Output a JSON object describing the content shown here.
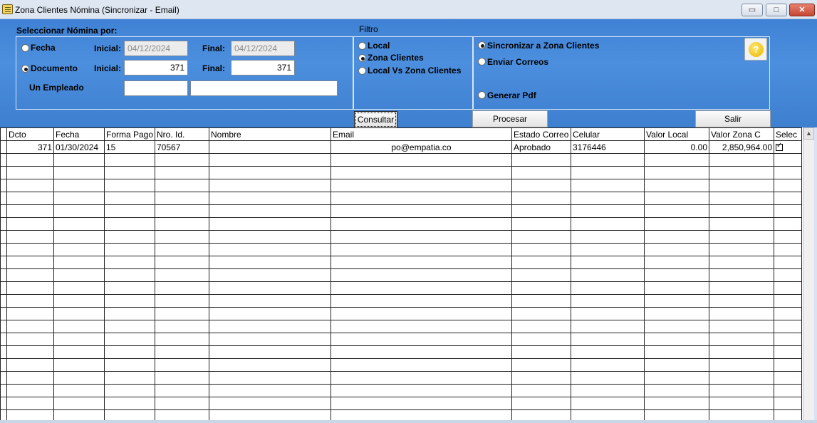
{
  "window": {
    "title": "Zona Clientes Nómina (Sincronizar - Email)",
    "min_label": "▭",
    "max_label": "□",
    "close_label": "✕"
  },
  "selection": {
    "heading": "Seleccionar Nómina por:",
    "fecha_label": "Fecha",
    "documento_label": "Documento",
    "inicial_label": "Inicial:",
    "final_label": "Final:",
    "fecha_inicial": "04/12/2024",
    "fecha_final": "04/12/2024",
    "doc_inicial": "371",
    "doc_final": "371",
    "empleado_label": "Un Empleado",
    "empleado_code": "",
    "empleado_name": "",
    "selected": "documento"
  },
  "filtro": {
    "heading": "Filtro",
    "options": [
      "Local",
      "Zona Clientes",
      "Local Vs Zona Clientes"
    ],
    "selected": "Zona Clientes"
  },
  "action": {
    "options": [
      "Sincronizar a Zona Clientes",
      "Enviar Correos",
      "Generar Pdf"
    ],
    "selected": "Sincronizar a Zona Clientes",
    "help_icon": "help-icon",
    "help_glyph": "?"
  },
  "buttons": {
    "consultar": "Consultar",
    "procesar": "Procesar",
    "salir": "Salir"
  },
  "table": {
    "columns": [
      "Dcto",
      "Fecha",
      "Forma Pago",
      "Nro. Id.",
      "Nombre",
      "Email",
      "Estado Correo",
      "Celular",
      "Valor Local",
      "Valor Zona C",
      "Selec"
    ],
    "rows": [
      {
        "dcto": "371",
        "fecha": "01/30/2024",
        "forma_pago": "15",
        "nro_id": "70567",
        "nombre": "",
        "email": "po@empatia.co",
        "estado": "Aprobado",
        "celular": "3176446",
        "valor_local": "0.00",
        "valor_zona": "2,850,964.00",
        "selec": true
      }
    ]
  },
  "colors": {
    "panel_blue": "#4c8fde",
    "close_red": "#c54634",
    "help_yellow": "#e8b800"
  }
}
